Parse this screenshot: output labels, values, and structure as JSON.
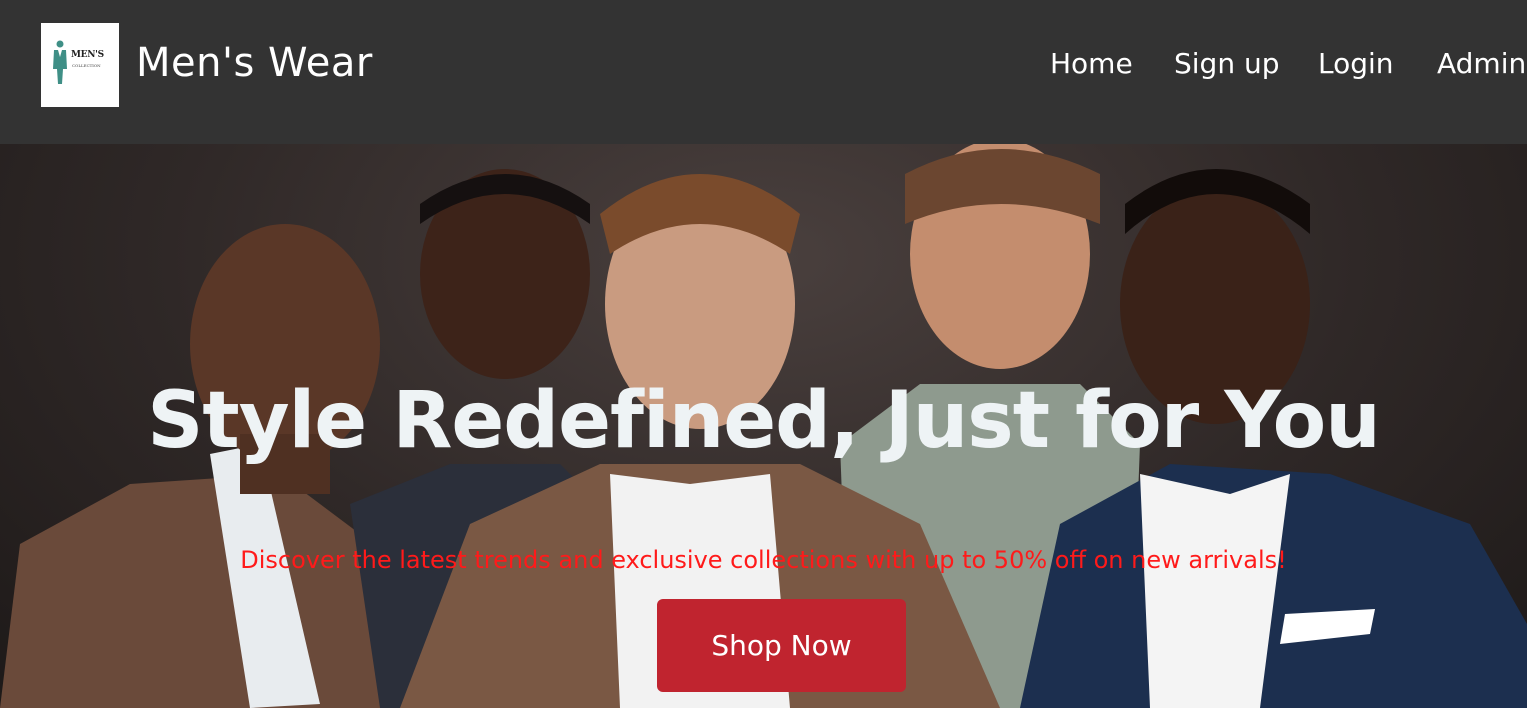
{
  "header": {
    "logo": {
      "text_line1": "MEN'S",
      "text_line2": "COLLECTION"
    },
    "brand": "Men's Wear",
    "nav": [
      {
        "label": "Home"
      },
      {
        "label": "Sign up"
      },
      {
        "label": "Login"
      },
      {
        "label": "Admin"
      }
    ]
  },
  "hero": {
    "headline": "Style Redefined, Just for You",
    "subline": "Discover the latest trends and exclusive collections with up to 50% off on new arrivals!",
    "cta_label": "Shop Now"
  },
  "colors": {
    "navbar_bg": "#333333",
    "headline": "#eef3f5",
    "subline": "#ff1a1a",
    "cta_bg": "#c0242f"
  }
}
